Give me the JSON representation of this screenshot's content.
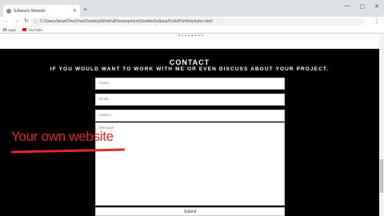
{
  "browser": {
    "tab_title": "Sultana's Website",
    "tab_close": "✕",
    "new_tab": "+",
    "window_controls": [
      "—",
      "▢",
      "✕"
    ],
    "nav_icons": [
      "←",
      "→",
      "↻"
    ],
    "url": "C:/Users/Sean/OneDrive/Desktop/WebFullDevelopment/SeeMe/Sultana/Folio/Portfolio/index.html",
    "menu": "⋮",
    "bookmarks": [
      {
        "label": "Apps",
        "icon": "apps-grid-icon"
      },
      {
        "label": "YouTube",
        "icon": "youtube-icon"
      }
    ]
  },
  "page": {
    "dots": "• • • • • • • •",
    "contact_title": "CONTACT",
    "contact_subtitle": "IF YOU WOULD WANT TO WORK WITH ME OR EVEN DISCUSS ABOUT YOUR PROJECT.",
    "form": {
      "name_placeholder": "Name",
      "email_placeholder": "Email",
      "subject_placeholder": "Subject",
      "message_placeholder": "Message",
      "submit_label": "Submit"
    }
  },
  "overlay": {
    "caption": "Your own website",
    "color": "#e0282a"
  }
}
